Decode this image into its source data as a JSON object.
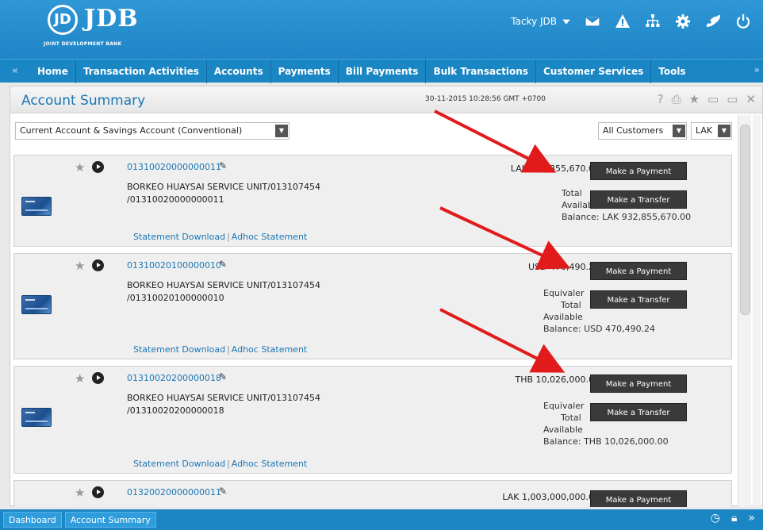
{
  "header": {
    "logo_mark": "JD",
    "logo_text": "JDB",
    "logo_subtitle": "JOINT DEVELOPMENT BANK",
    "user_name": "Tacky JDB",
    "icons": [
      "chevron-down-icon",
      "mail-icon",
      "warning-icon",
      "sitemap-icon",
      "settings-icon",
      "phone-icon",
      "power-icon"
    ]
  },
  "nav": {
    "left_arrow": "«",
    "right_arrow": "»",
    "items": [
      "Home",
      "Transaction Activities",
      "Accounts",
      "Payments",
      "Bill Payments",
      "Bulk Transactions",
      "Customer Services",
      "Tools"
    ]
  },
  "panel": {
    "title": "Account Summary",
    "datetime": "30-11-2015 10:28:56 GMT +0700",
    "tools": [
      "?",
      "⎙",
      "★",
      "▭",
      "▭",
      "✕"
    ]
  },
  "filters": {
    "account_type": "Current Account & Savings Account (Conventional)",
    "customers": "All Customers",
    "currency": "LAK"
  },
  "accounts": [
    {
      "number": "01310020000000011",
      "name_line1": "BORKEO HUAYSAI SERVICE UNIT/013107454",
      "name_line2": "/01310020000000011",
      "balance": "LAK 932,855,670.00",
      "info_line1": "Total",
      "info_line2": "Available",
      "info_line3": "Balance: LAK 932,855,670.00",
      "equiv": "",
      "pay_label": "Make a Payment",
      "transfer_label": "Make a Transfer",
      "statement_label": "Statement Download",
      "adhoc_label": "Adhoc Statement"
    },
    {
      "number": "01310020100000010",
      "name_line1": "BORKEO HUAYSAI SERVICE UNIT/013107454",
      "name_line2": "/01310020100000010",
      "balance": "USD 470,490.24",
      "equiv": "Equivaler",
      "info_line1": "Total",
      "info_line2": "Available",
      "info_line3": "Balance: USD 470,490.24",
      "pay_label": "Make a Payment",
      "transfer_label": "Make a Transfer",
      "statement_label": "Statement Download",
      "adhoc_label": "Adhoc Statement"
    },
    {
      "number": "01310020200000018",
      "name_line1": "BORKEO HUAYSAI SERVICE UNIT/013107454",
      "name_line2": "/01310020200000018",
      "balance": "THB 10,026,000.00",
      "equiv": "Equivaler",
      "info_line1": "Total",
      "info_line2": "Available",
      "info_line3": "Balance: THB 10,026,000.00",
      "pay_label": "Make a Payment",
      "transfer_label": "Make a Transfer",
      "statement_label": "Statement Download",
      "adhoc_label": "Adhoc Statement"
    },
    {
      "number": "01320020000000011",
      "balance": "LAK 1,003,000,000.00",
      "pay_label": "Make a Payment"
    }
  ],
  "footer": {
    "tabs": [
      "Dashboard",
      "Account Summary"
    ],
    "icons": [
      "clock-icon",
      "lock-icon",
      "chevron-double-down-icon"
    ]
  },
  "annotation_color": "#e11b1b"
}
